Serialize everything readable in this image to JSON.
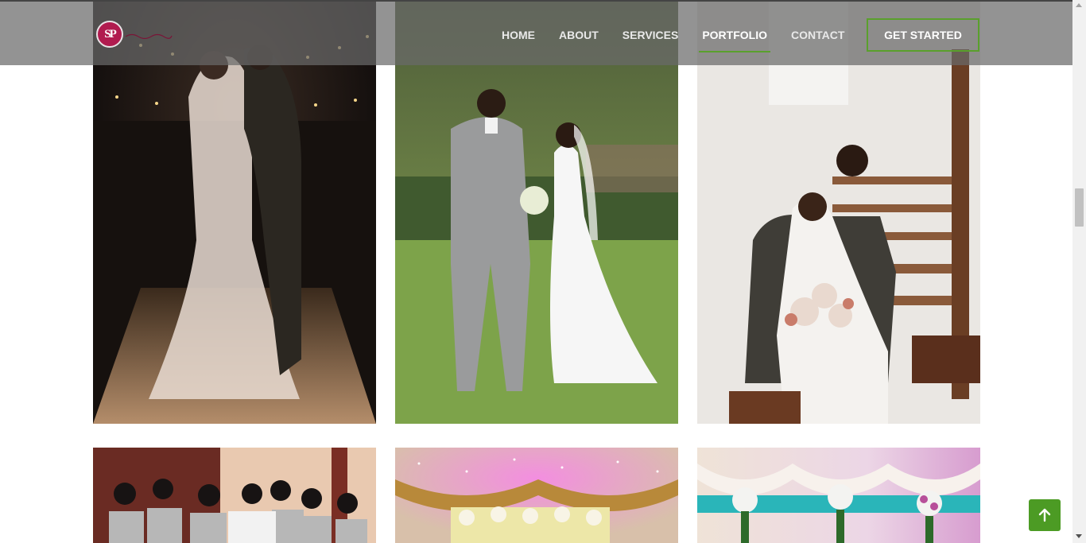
{
  "brand": {
    "logo_monogram": "SP",
    "logo_alt": "SP logo"
  },
  "nav": {
    "items": [
      {
        "label": "HOME",
        "active": false
      },
      {
        "label": "ABOUT",
        "active": false
      },
      {
        "label": "SERVICES",
        "active": false
      },
      {
        "label": "PORTFOLIO",
        "active": true
      },
      {
        "label": "CONTACT",
        "active": false
      }
    ],
    "cta_label": "GET STARTED"
  },
  "colors": {
    "accent": "#5aa02c",
    "header_overlay": "#696969",
    "back_to_top": "#4c9b24",
    "logo": "#b11b4f"
  },
  "gallery": {
    "photos": [
      {
        "name": "photo-couple-night-tent"
      },
      {
        "name": "photo-couple-garden"
      },
      {
        "name": "photo-couple-staircase"
      },
      {
        "name": "photo-bridesmaids"
      },
      {
        "name": "photo-decor-pink-lights"
      },
      {
        "name": "photo-decor-flowers"
      }
    ]
  },
  "icons": {
    "back_to_top": "arrow-up-icon"
  }
}
